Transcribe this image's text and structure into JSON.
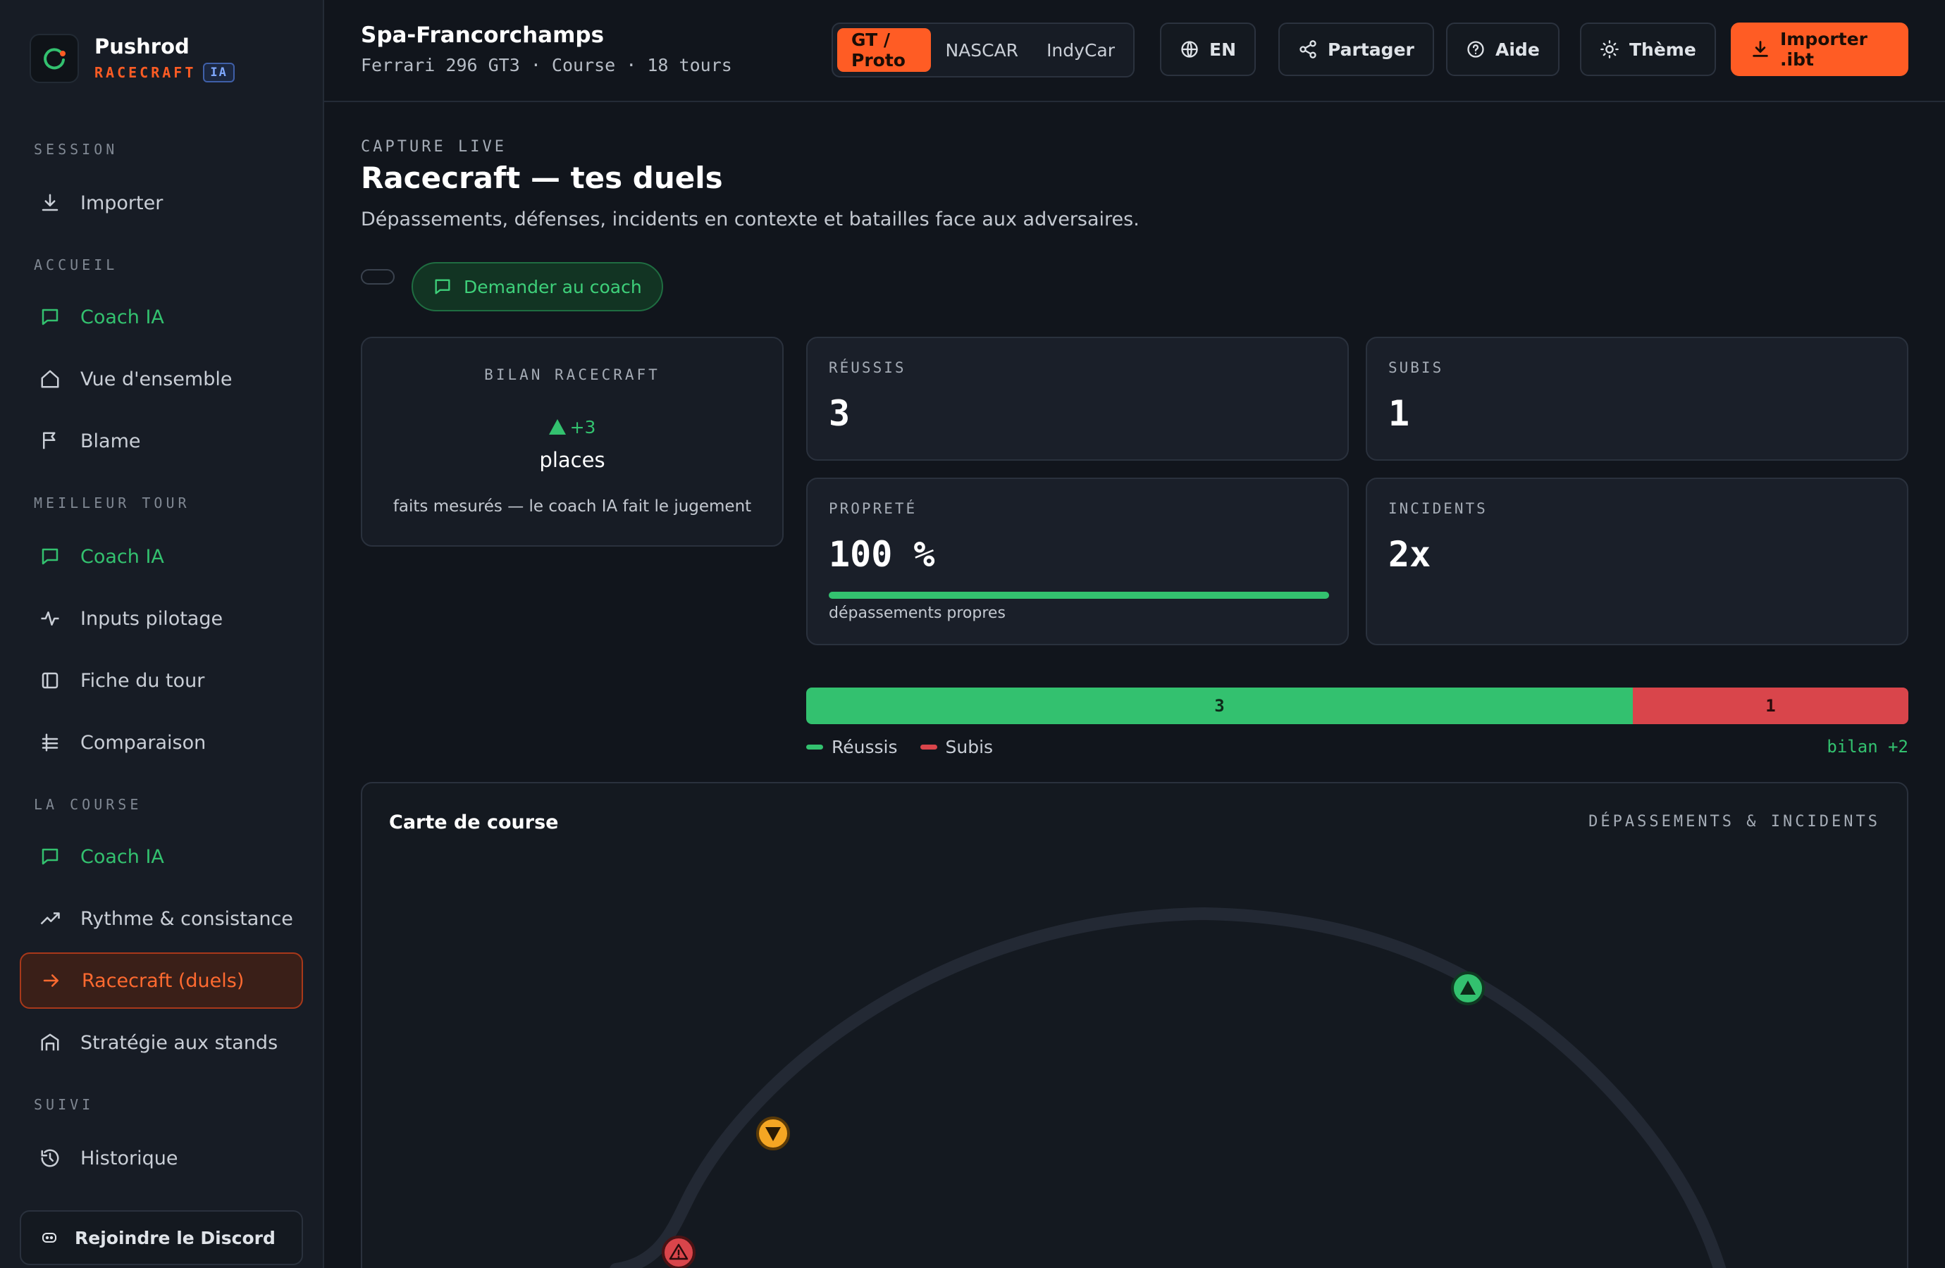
{
  "brand": {
    "name": "Pushrod",
    "sub": "RACECRAFT",
    "badge": "IA"
  },
  "sidebar": {
    "sections": [
      {
        "label": "SESSION"
      },
      {
        "label": "ACCUEIL"
      },
      {
        "label": "MEILLEUR TOUR"
      },
      {
        "label": "LA COURSE"
      },
      {
        "label": "SUIVI"
      }
    ],
    "items": [
      {
        "label": "Importer",
        "icon": "download-icon"
      },
      {
        "label": "Coach IA",
        "icon": "chat-icon"
      },
      {
        "label": "Vue d'ensemble",
        "icon": "home-icon"
      },
      {
        "label": "Blame",
        "icon": "flag-icon"
      },
      {
        "label": "Coach IA",
        "icon": "chat-icon"
      },
      {
        "label": "Inputs pilotage",
        "icon": "pulse-icon"
      },
      {
        "label": "Fiche du tour",
        "icon": "sheet-icon"
      },
      {
        "label": "Comparaison",
        "icon": "compare-icon"
      },
      {
        "label": "Coach IA",
        "icon": "chat-icon"
      },
      {
        "label": "Rythme & consistance",
        "icon": "trend-icon"
      },
      {
        "label": "Racecraft (duels)",
        "icon": "arrow-right-icon"
      },
      {
        "label": "Stratégie aux stands",
        "icon": "garage-icon"
      },
      {
        "label": "Historique",
        "icon": "history-icon"
      }
    ],
    "discord": "Rejoindre le Discord"
  },
  "topbar": {
    "track": "Spa-Francorchamps",
    "session": "Ferrari 296 GT3 · Course · 18 tours",
    "series": [
      "GT / Proto",
      "NASCAR",
      "IndyCar"
    ],
    "series_selected": "GT / Proto",
    "lang": "EN",
    "share": "Partager",
    "help": "Aide",
    "theme": "Thème",
    "import": "Importer .ibt"
  },
  "main": {
    "eyebrow": "CAPTURE LIVE",
    "title": "Racecraft — tes duels",
    "description": "Dépassements, défenses, incidents en contexte et batailles face aux adversaires.",
    "coach_button": "Demander au coach",
    "bilan": {
      "label": "BILAN RACECRAFT",
      "delta": "+3",
      "unit": "places",
      "note": "faits mesurés — le coach IA fait le jugement"
    },
    "stats": {
      "reussis": {
        "label": "RÉUSSIS",
        "value": "3"
      },
      "subis": {
        "label": "SUBIS",
        "value": "1"
      },
      "proprete": {
        "label": "PROPRETÉ",
        "value": "100 %",
        "progress": 1.0,
        "caption": "dépassements propres"
      },
      "incidents": {
        "label": "INCIDENTS",
        "value": "2x"
      }
    },
    "duels": {
      "won": 3,
      "lost": 1,
      "won_label": "3",
      "lost_label": "1",
      "legend_won": "Réussis",
      "legend_lost": "Subis",
      "total": "bilan +2"
    },
    "map": {
      "title": "Carte de course",
      "subtitle": "DÉPASSEMENTS & INCIDENTS",
      "markers": [
        "overtake-icon",
        "lost-position-icon",
        "incident-icon"
      ]
    }
  },
  "colors": {
    "accent": "#ff5c24",
    "green": "#33c16f",
    "red": "#d9454b",
    "amber": "#f5a623",
    "background": "#11151c",
    "card": "#1a1f29"
  }
}
